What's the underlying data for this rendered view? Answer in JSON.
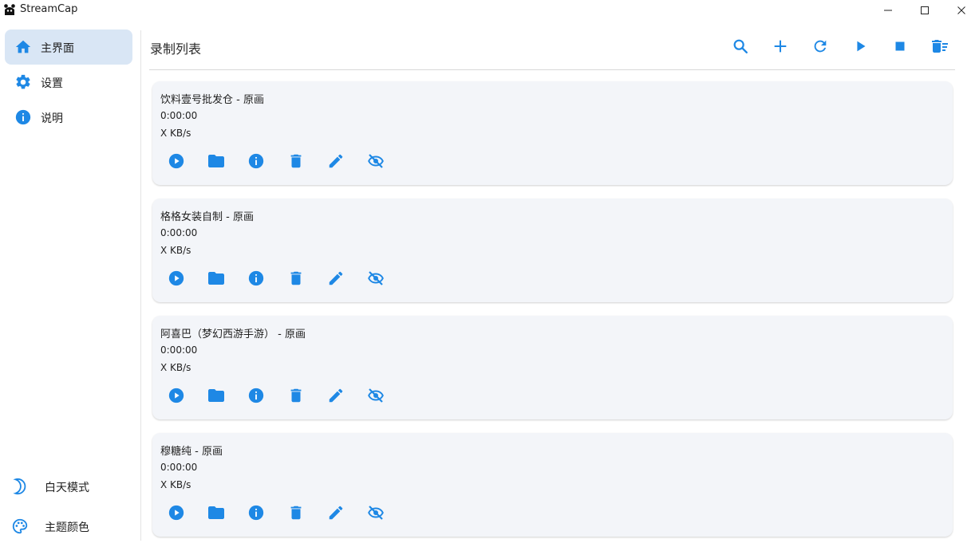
{
  "window": {
    "title": "StreamCap"
  },
  "sidebar": {
    "items": [
      {
        "label": "主界面",
        "icon": "home-icon",
        "active": true
      },
      {
        "label": "设置",
        "icon": "gear-icon",
        "active": false
      },
      {
        "label": "说明",
        "icon": "info-icon",
        "active": false
      }
    ],
    "bottom": [
      {
        "label": "白天模式",
        "icon": "moon-icon"
      },
      {
        "label": "主题颜色",
        "icon": "palette-icon"
      }
    ]
  },
  "main": {
    "title": "录制列表",
    "toolbar": [
      "search-icon",
      "plus-icon",
      "refresh-icon",
      "play-icon",
      "stop-icon",
      "delete-sweep-icon"
    ]
  },
  "recordings": [
    {
      "title": "饮料壹号批发仓 - 原画",
      "time": "0:00:00",
      "speed": "X KB/s"
    },
    {
      "title": "格格女装自制 - 原画",
      "time": "0:00:00",
      "speed": "X KB/s"
    },
    {
      "title": "阿喜巴（梦幻西游手游） - 原画",
      "time": "0:00:00",
      "speed": "X KB/s"
    },
    {
      "title": "穆糖纯 - 原画",
      "time": "0:00:00",
      "speed": "X KB/s"
    }
  ],
  "card_actions": [
    "play-circle-icon",
    "folder-icon",
    "info-icon",
    "trash-icon",
    "pencil-icon",
    "eye-off-icon"
  ],
  "colors": {
    "accent": "#1e88e5",
    "active_nav_bg": "#d9e6f5",
    "card_bg": "#f3f5f9"
  }
}
